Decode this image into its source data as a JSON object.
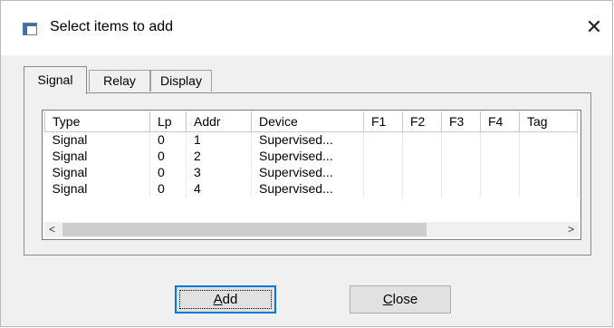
{
  "window": {
    "title": "Select items to add",
    "close_glyph": "✕"
  },
  "tabs": [
    {
      "label": "Signal",
      "active": true
    },
    {
      "label": "Relay",
      "active": false
    },
    {
      "label": "Display",
      "active": false
    }
  ],
  "table": {
    "columns": [
      "Type",
      "Lp",
      "Addr",
      "Device",
      "F1",
      "F2",
      "F3",
      "F4",
      "Tag"
    ],
    "rows": [
      [
        "Signal",
        "0",
        "1",
        "Supervised...",
        "",
        "",
        "",
        "",
        ""
      ],
      [
        "Signal",
        "0",
        "2",
        "Supervised...",
        "",
        "",
        "",
        "",
        ""
      ],
      [
        "Signal",
        "0",
        "3",
        "Supervised...",
        "",
        "",
        "",
        "",
        ""
      ],
      [
        "Signal",
        "0",
        "4",
        "Supervised...",
        "",
        "",
        "",
        "",
        ""
      ]
    ]
  },
  "scrollbar": {
    "left_glyph": "<",
    "right_glyph": ">"
  },
  "buttons": {
    "add": {
      "mnemonic": "A",
      "rest": "dd"
    },
    "close": {
      "mnemonic": "C",
      "rest": "lose"
    }
  }
}
